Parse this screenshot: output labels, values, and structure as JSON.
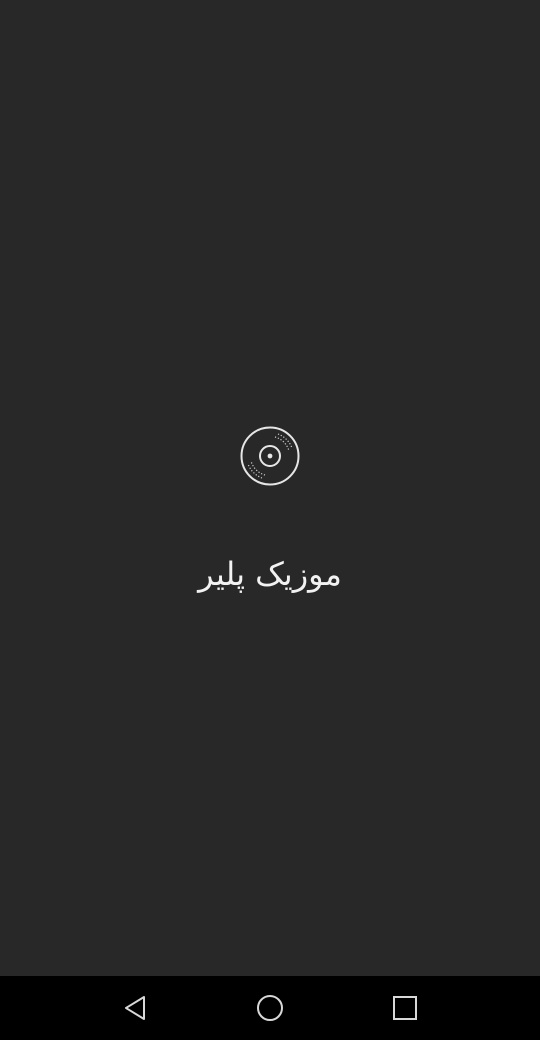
{
  "app": {
    "title": "موزیک پلیر",
    "logo_icon": "vinyl-disc-icon"
  },
  "navigation_bar": {
    "buttons": [
      {
        "name": "back",
        "icon": "triangle-back-icon"
      },
      {
        "name": "home",
        "icon": "circle-home-icon"
      },
      {
        "name": "recents",
        "icon": "square-recents-icon"
      }
    ]
  },
  "colors": {
    "background": "#282828",
    "nav_background": "#000000",
    "foreground": "#f2f2f2"
  }
}
